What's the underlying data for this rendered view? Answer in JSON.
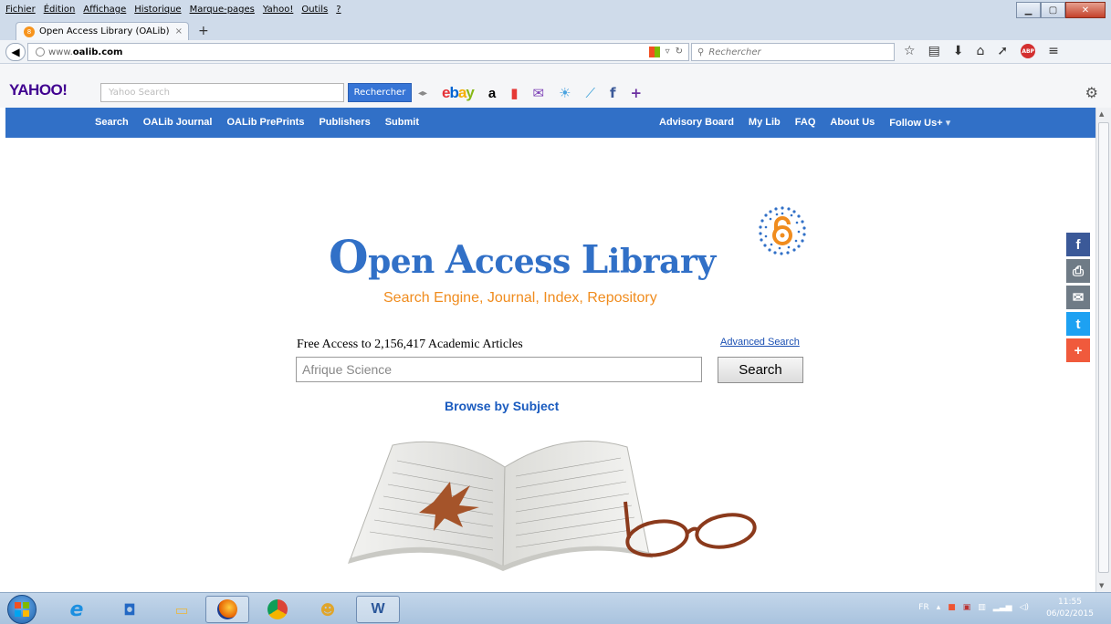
{
  "menu": {
    "items": [
      "Fichier",
      "Édition",
      "Affichage",
      "Historique",
      "Marque-pages",
      "Yahoo!",
      "Outils",
      "?"
    ]
  },
  "tab": {
    "title": "Open Access Library (OALib)",
    "close": "×",
    "new": "+"
  },
  "nav": {
    "url_prefix": "www.",
    "url_host": "oalib.com",
    "search_placeholder": "Rechercher"
  },
  "yahoo": {
    "logo": "YAHOO!",
    "search_placeholder": "Yahoo Search",
    "button": "Rechercher",
    "ebay": "ebay",
    "amazon": "a"
  },
  "site_nav": {
    "left": [
      "Search",
      "OALib Journal",
      "OALib PrePrints",
      "Publishers",
      "Submit"
    ],
    "right": [
      "Advisory Board",
      "My Lib",
      "FAQ",
      "About Us",
      "Follow Us+"
    ]
  },
  "main": {
    "logo_o": "O",
    "logo_pen": "pen ",
    "logo_a": "A",
    "logo_ccess": "ccess ",
    "logo_l": "L",
    "logo_ibrary": "ibrary",
    "tagline": "Search  Engine, Journal, Index, Repository",
    "free_access": "Free Access to 2,156,417 Academic Articles",
    "advanced_search": "Advanced Search",
    "search_value": "Afrique Science",
    "search_button": "Search",
    "browse": "Browse by Subject"
  },
  "social": {
    "facebook": "f",
    "print": "⎙",
    "email": "✉",
    "twitter": "t",
    "more": "+"
  },
  "taskbar": {
    "language": "FR",
    "time": "11:55",
    "date": "06/02/2015"
  },
  "colors": {
    "brand_blue": "#3170c7",
    "tagline_orange": "#f08c1e",
    "facebook": "#3b5998",
    "twitter": "#1da1f2",
    "plus": "#f05a3c"
  }
}
